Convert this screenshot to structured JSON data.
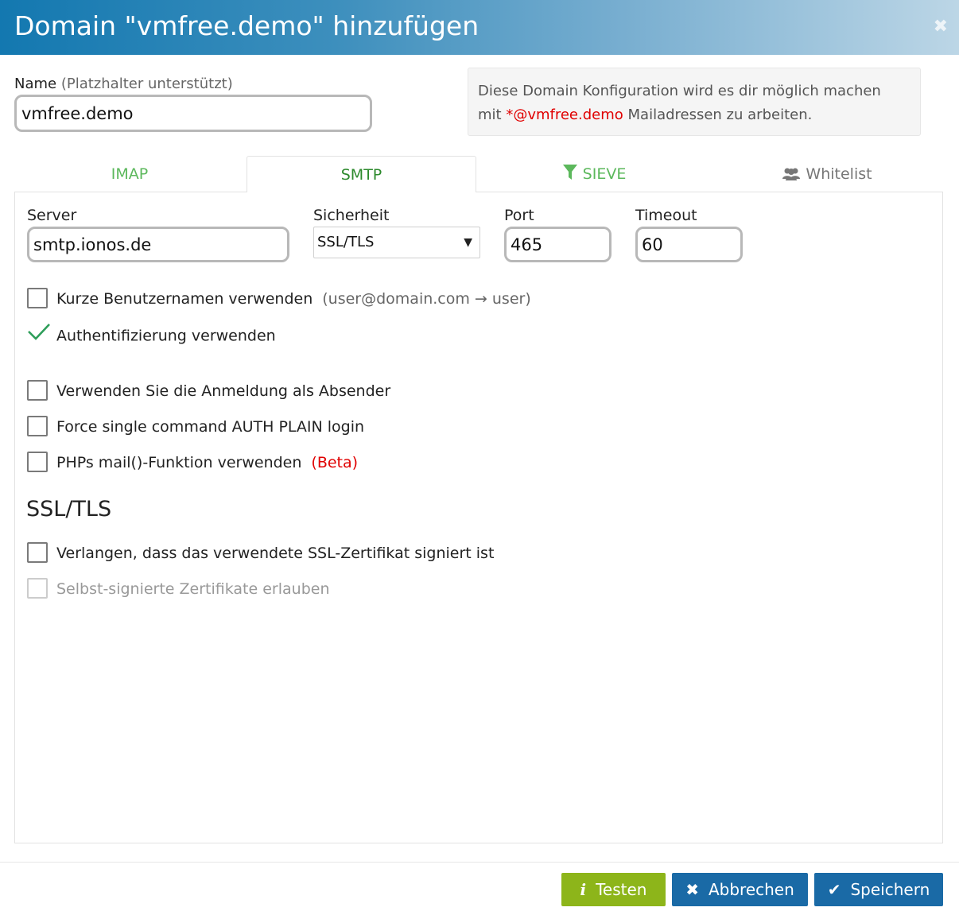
{
  "dialog": {
    "title": "Domain \"vmfree.demo\" hinzufügen",
    "close_icon": "close-icon"
  },
  "name": {
    "label": "Name",
    "hint": "(Platzhalter unterstützt)",
    "value": "vmfree.demo"
  },
  "info": {
    "line1": "Diese Domain Konfiguration wird es dir möglich machen",
    "prefix": "mit ",
    "highlight": "*@vmfree.demo",
    "suffix": " Mailadressen zu arbeiten."
  },
  "tabs": [
    {
      "label": "IMAP",
      "active": false
    },
    {
      "label": "SMTP",
      "active": true
    },
    {
      "label": "SIEVE",
      "icon": "filter-icon",
      "active": false
    },
    {
      "label": "Whitelist",
      "icon": "users-icon",
      "active": false
    }
  ],
  "smtp": {
    "server_label": "Server",
    "server_value": "smtp.ionos.de",
    "security_label": "Sicherheit",
    "security_value": "SSL/TLS",
    "port_label": "Port",
    "port_value": "465",
    "timeout_label": "Timeout",
    "timeout_value": "60"
  },
  "options": {
    "short_usernames": {
      "label": "Kurze Benutzernamen verwenden",
      "hint": "(user@domain.com → user)",
      "checked": false
    },
    "use_auth": {
      "label": "Authentifizierung verwenden",
      "checked": true
    },
    "login_as_sender": {
      "label": "Verwenden Sie die Anmeldung als Absender",
      "checked": false
    },
    "force_auth_plain": {
      "label": "Force single command AUTH PLAIN login",
      "checked": false
    },
    "php_mail": {
      "label": "PHPs mail()-Funktion verwenden",
      "badge": "(Beta)",
      "checked": false
    }
  },
  "ssl_section": {
    "title": "SSL/TLS",
    "verify_cert": {
      "label": "Verlangen, dass das verwendete SSL-Zertifikat signiert ist",
      "checked": false
    },
    "allow_self_signed": {
      "label": "Selbst-signierte Zertifikate erlauben",
      "checked": false,
      "disabled": true
    }
  },
  "buttons": {
    "test": {
      "label": "Testen",
      "icon": "info-icon",
      "color": "#8db51a"
    },
    "cancel": {
      "label": "Abbrechen",
      "icon": "x-icon",
      "color": "#1a6aa6"
    },
    "save": {
      "label": "Speichern",
      "icon": "check-icon",
      "color": "#1a6aa6"
    }
  },
  "colors": {
    "accent_green": "#5cb85c",
    "primary_blue": "#1a6aa6",
    "highlight_red": "#e00000"
  }
}
